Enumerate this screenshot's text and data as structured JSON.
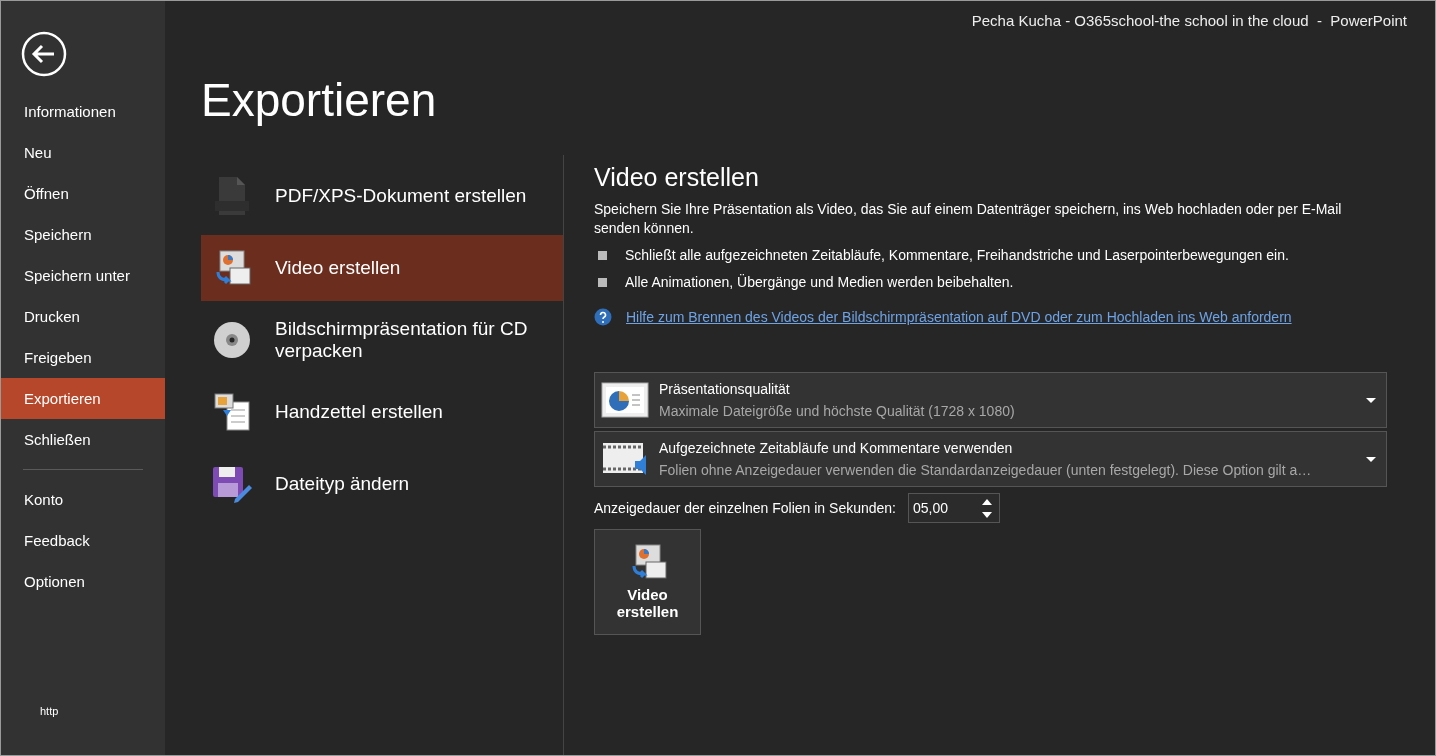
{
  "window": {
    "title": "Pecha Kucha - O365school-the school in the cloud  -  PowerPoint"
  },
  "sidebar": {
    "items": [
      {
        "label": "Informationen",
        "selected": false
      },
      {
        "label": "Neu",
        "selected": false
      },
      {
        "label": "Öffnen",
        "selected": false
      },
      {
        "label": "Speichern",
        "selected": false
      },
      {
        "label": "Speichern unter",
        "selected": false
      },
      {
        "label": "Drucken",
        "selected": false
      },
      {
        "label": "Freigeben",
        "selected": false
      },
      {
        "label": "Exportieren",
        "selected": true
      },
      {
        "label": "Schließen",
        "selected": false
      }
    ],
    "secondary_items": [
      {
        "label": "Konto",
        "selected": false
      },
      {
        "label": "Feedback",
        "selected": false
      },
      {
        "label": "Optionen",
        "selected": false
      }
    ],
    "footer": "http"
  },
  "page_title": "Exportieren",
  "export_options": [
    {
      "kind": "pdf",
      "label": "PDF/XPS-Dokument erstellen",
      "selected": false
    },
    {
      "kind": "video",
      "label": "Video erstellen",
      "selected": true
    },
    {
      "kind": "cd",
      "label": "Bildschirmpräsentation für CD verpacken",
      "selected": false
    },
    {
      "kind": "handout",
      "label": "Handzettel erstellen",
      "selected": false
    },
    {
      "kind": "filetype",
      "label": "Dateityp ändern",
      "selected": false
    }
  ],
  "video_panel": {
    "heading": "Video erstellen",
    "description": "Speichern Sie Ihre Präsentation als Video, das Sie auf einem Datenträger speichern, ins Web hochladen oder per E-Mail senden können.",
    "bullets": [
      "Schließt alle aufgezeichneten Zeitabläufe, Kommentare, Freihandstriche und Laserpointerbewegungen ein.",
      "Alle Animationen, Übergänge und Medien werden beibehalten."
    ],
    "help_link": "Hilfe zum Brennen des Videos der Bildschirmpräsentation auf DVD oder zum Hochladen ins Web anfordern",
    "dropdowns": [
      {
        "kind": "quality",
        "title": "Präsentationsqualität",
        "subtitle": "Maximale Dateigröße und höchste Qualität (1728 x 1080)"
      },
      {
        "kind": "timings",
        "title": "Aufgezeichnete Zeitabläufe und Kommentare verwenden",
        "subtitle": "Folien ohne Anzeigedauer verwenden die Standardanzeigedauer (unten festgelegt). Diese Option gilt a…"
      }
    ],
    "duration": {
      "label": "Anzeigedauer der einzelnen Folien in Sekunden:",
      "value": "05,00"
    },
    "create_button": {
      "label": "Video erstellen"
    }
  }
}
